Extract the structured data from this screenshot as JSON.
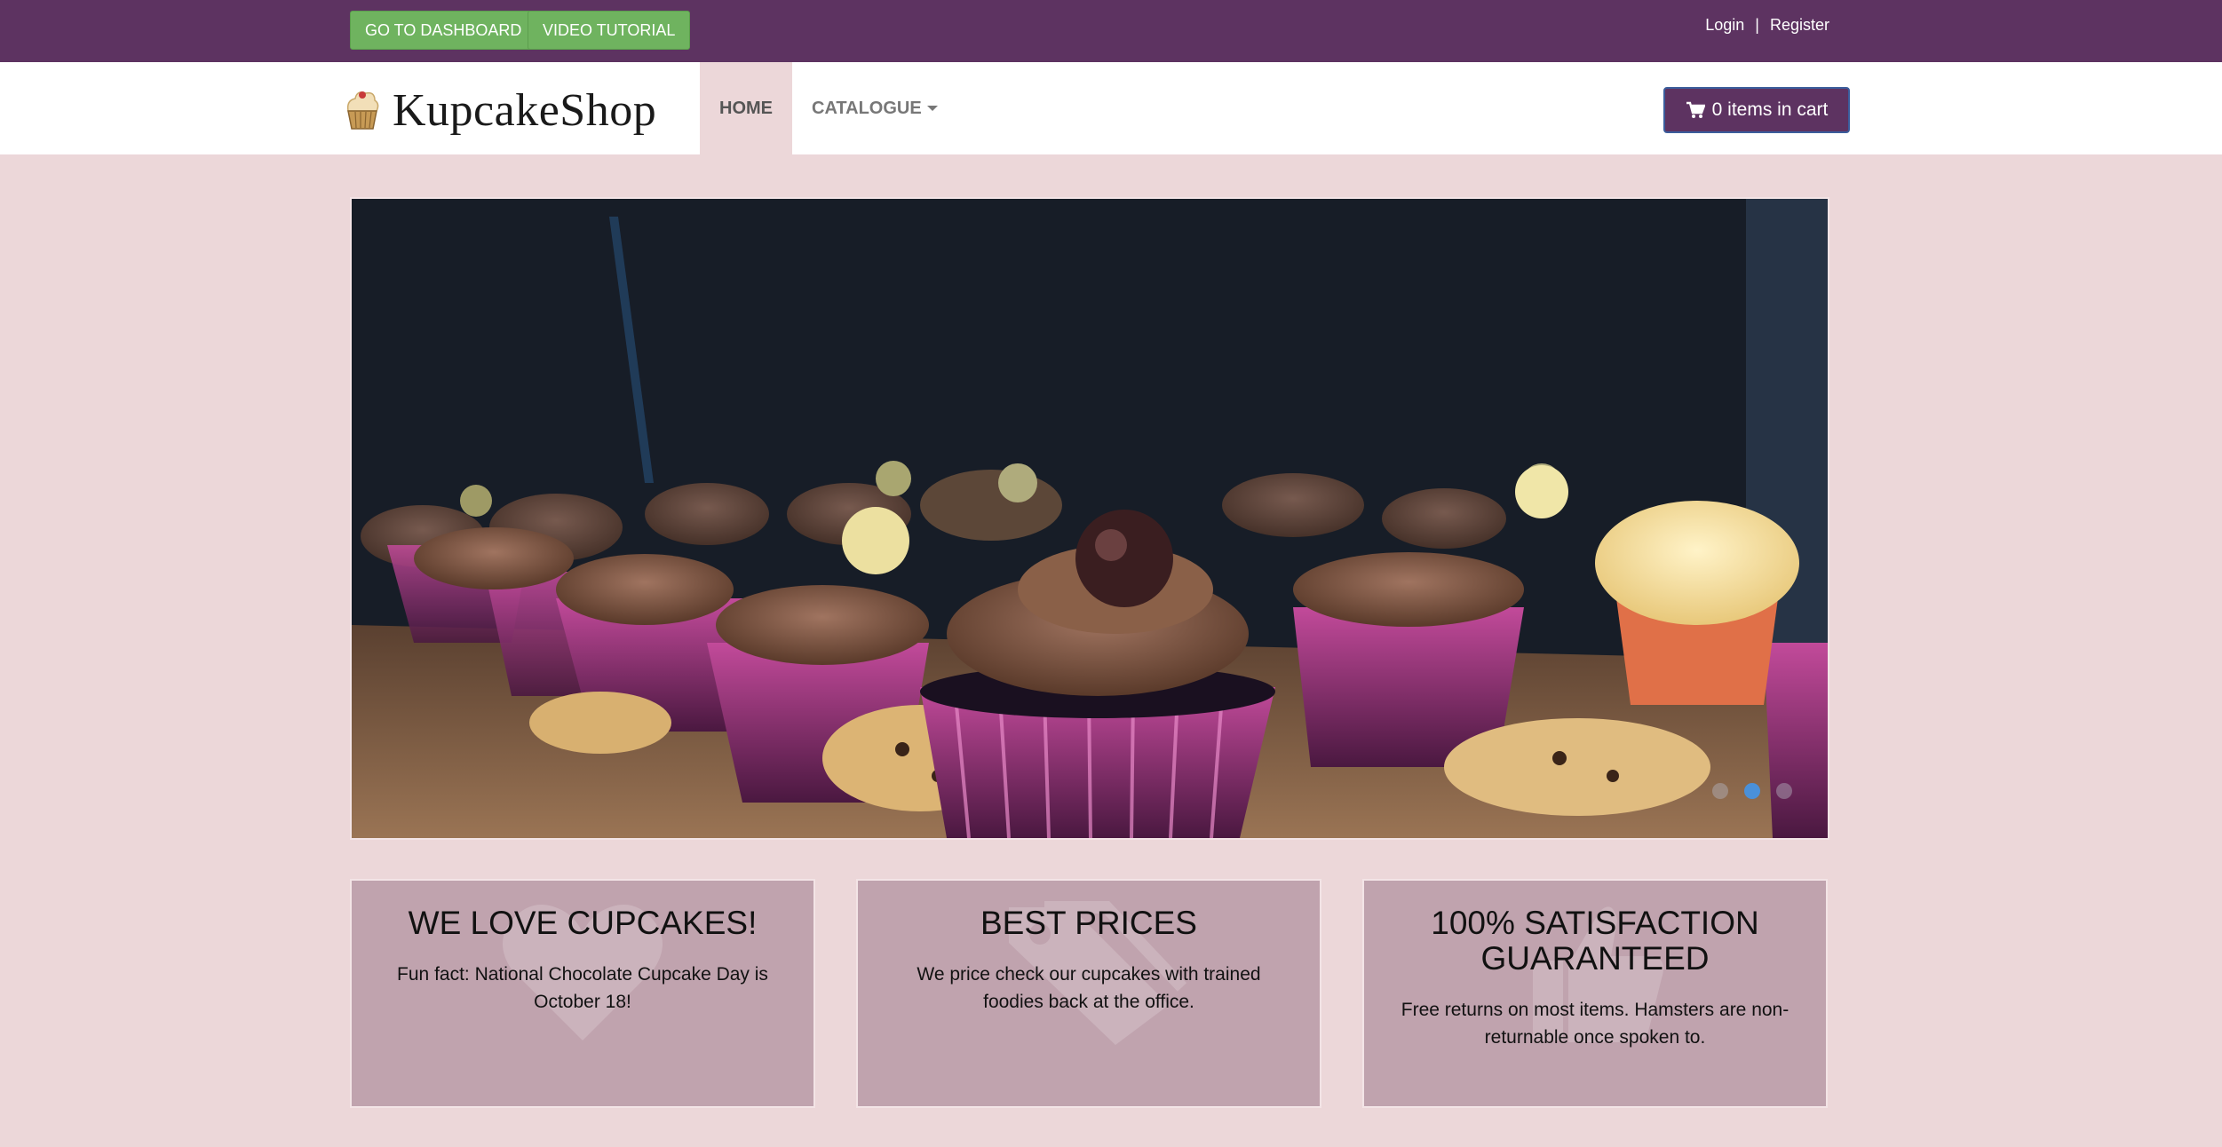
{
  "topbar": {
    "dashboard_label": "GO TO DASHBOARD",
    "video_label": "VIDEO TUTORIAL",
    "login": "Login",
    "separator": "|",
    "register": "Register"
  },
  "navbar": {
    "logo_text": "KupcakeShop",
    "home": "HOME",
    "catalogue": "CATALOGUE",
    "cart": "0 items in cart"
  },
  "carousel": {
    "slides": 3,
    "active_slide": 2
  },
  "features": [
    {
      "title": "WE LOVE CUPCAKES!",
      "text": "Fun fact: National Chocolate Cupcake Day is October 18!",
      "icon": "heart-icon"
    },
    {
      "title": "BEST PRICES",
      "text": "We price check our cupcakes with trained foodies back at the office.",
      "icon": "tag-icon"
    },
    {
      "title": "100% SATISFACTION GUARANTEED",
      "text": "Free returns on most items. Hamsters are non-returnable once spoken to.",
      "icon": "thumbs-up-icon"
    }
  ],
  "colors": {
    "topbar": "#5d3361",
    "button_green": "#6fb35f",
    "page_bg": "#ecd7d9",
    "feature_bg": "#c0a3ae",
    "dot_active": "#4a90d9"
  }
}
